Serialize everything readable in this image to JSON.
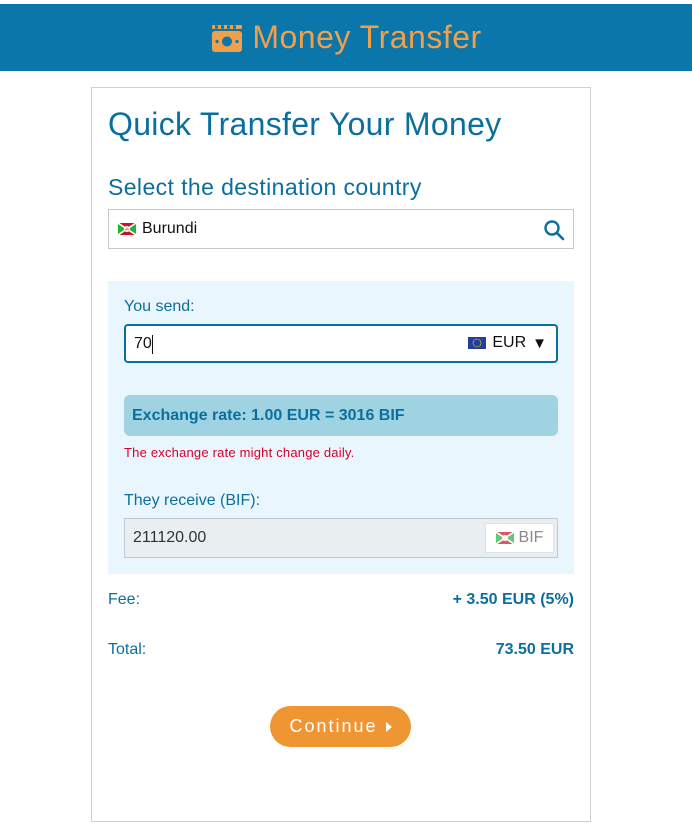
{
  "header": {
    "title": "Money Transfer",
    "icon": "money-bill-icon",
    "brand_color": "#f0a04b",
    "bar_color": "#0b76a9"
  },
  "card": {
    "title": "Quick Transfer Your Money",
    "subtitle": "Select the destination country",
    "country": {
      "value": "Burundi",
      "flag": "burundi-flag-icon",
      "search_icon": "search-icon"
    }
  },
  "send": {
    "label": "You send:",
    "amount": "70",
    "currency": "EUR",
    "currency_flag": "eu-flag-icon",
    "dropdown_glyph": "▼"
  },
  "rate": {
    "text": "Exchange rate: 1.00 EUR = 3016 BIF",
    "note": "The exchange rate might change daily."
  },
  "receive": {
    "label": "They receive (BIF):",
    "amount": "211120.00",
    "currency": "BIF",
    "currency_flag": "burundi-flag-icon"
  },
  "summary": {
    "fee_label": "Fee:",
    "fee_value": "+ 3.50 EUR (5%)",
    "total_label": "Total:",
    "total_value": "73.50 EUR"
  },
  "actions": {
    "continue_label": "Continue"
  },
  "colors": {
    "primary": "#0b6f9e",
    "accent": "#ef9632",
    "warning": "#d5002b",
    "panel_bg": "#eaf6fd",
    "rate_bg": "#9fd3e2"
  }
}
